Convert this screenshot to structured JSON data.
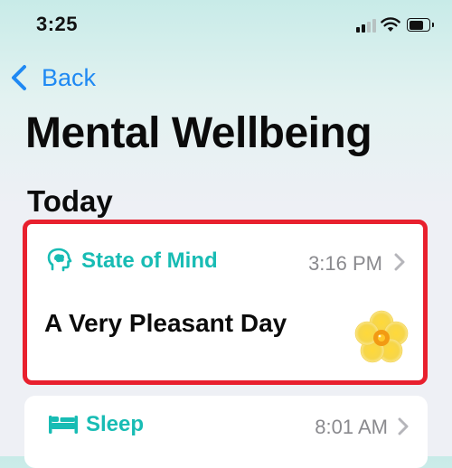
{
  "status_bar": {
    "time": "3:25"
  },
  "nav": {
    "back_label": "Back"
  },
  "page": {
    "title": "Mental Wellbeing"
  },
  "section": {
    "title": "Today"
  },
  "cards": [
    {
      "label": "State of Mind",
      "time": "3:16 PM",
      "value": "A Very Pleasant Day",
      "icon": "brain-icon",
      "value_icon": "flower-icon",
      "highlight_color": "#e8202e"
    },
    {
      "label": "Sleep",
      "time": "8:01 AM",
      "icon": "bed-icon"
    }
  ],
  "colors": {
    "accent_teal": "#18bcb4",
    "link_blue": "#1f89f3",
    "secondary_gray": "#8a8a8e"
  }
}
